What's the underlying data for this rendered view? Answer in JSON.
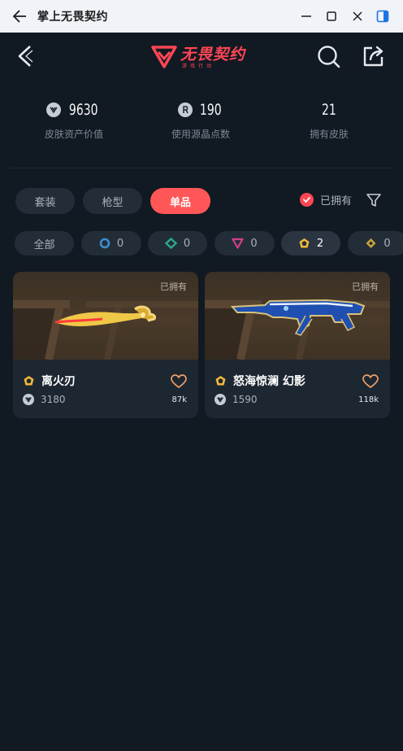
{
  "window": {
    "title": "掌上无畏契约"
  },
  "header": {
    "logo_text": "无畏契约",
    "logo_sub": "游戏行动"
  },
  "stats": [
    {
      "value": "9630",
      "label": "皮肤资产价值",
      "icon": "vp-icon"
    },
    {
      "value": "190",
      "label": "使用源晶点数",
      "icon": "radianite-icon"
    },
    {
      "value": "21",
      "label": "拥有皮肤",
      "icon": ""
    }
  ],
  "tabs": [
    {
      "label": "套装",
      "active": false
    },
    {
      "label": "枪型",
      "active": false
    },
    {
      "label": "单品",
      "active": true
    }
  ],
  "owned_filter": {
    "label": "已拥有",
    "checked": true
  },
  "tiers": [
    {
      "label": "全部",
      "count": "",
      "color": ""
    },
    {
      "label": "",
      "count": "0",
      "color": "#3b8fd0",
      "tier": "select"
    },
    {
      "label": "",
      "count": "0",
      "color": "#2aa98f",
      "tier": "deluxe"
    },
    {
      "label": "",
      "count": "0",
      "color": "#d0408a",
      "tier": "premium"
    },
    {
      "label": "",
      "count": "2",
      "color": "#f2b83a",
      "tier": "exclusive",
      "selected": true
    },
    {
      "label": "",
      "count": "0",
      "color": "#c8a43a",
      "tier": "ultra"
    }
  ],
  "items": [
    {
      "owned_tag": "已拥有",
      "name": "离火刃",
      "price": "3180",
      "likes": "87k"
    },
    {
      "owned_tag": "已拥有",
      "name": "怒海惊澜 幻影",
      "price": "1590",
      "likes": "118k"
    }
  ],
  "colors": {
    "accent": "#ff5757",
    "brand": "#ff4655",
    "background": "#111922",
    "card": "#1d2732"
  }
}
